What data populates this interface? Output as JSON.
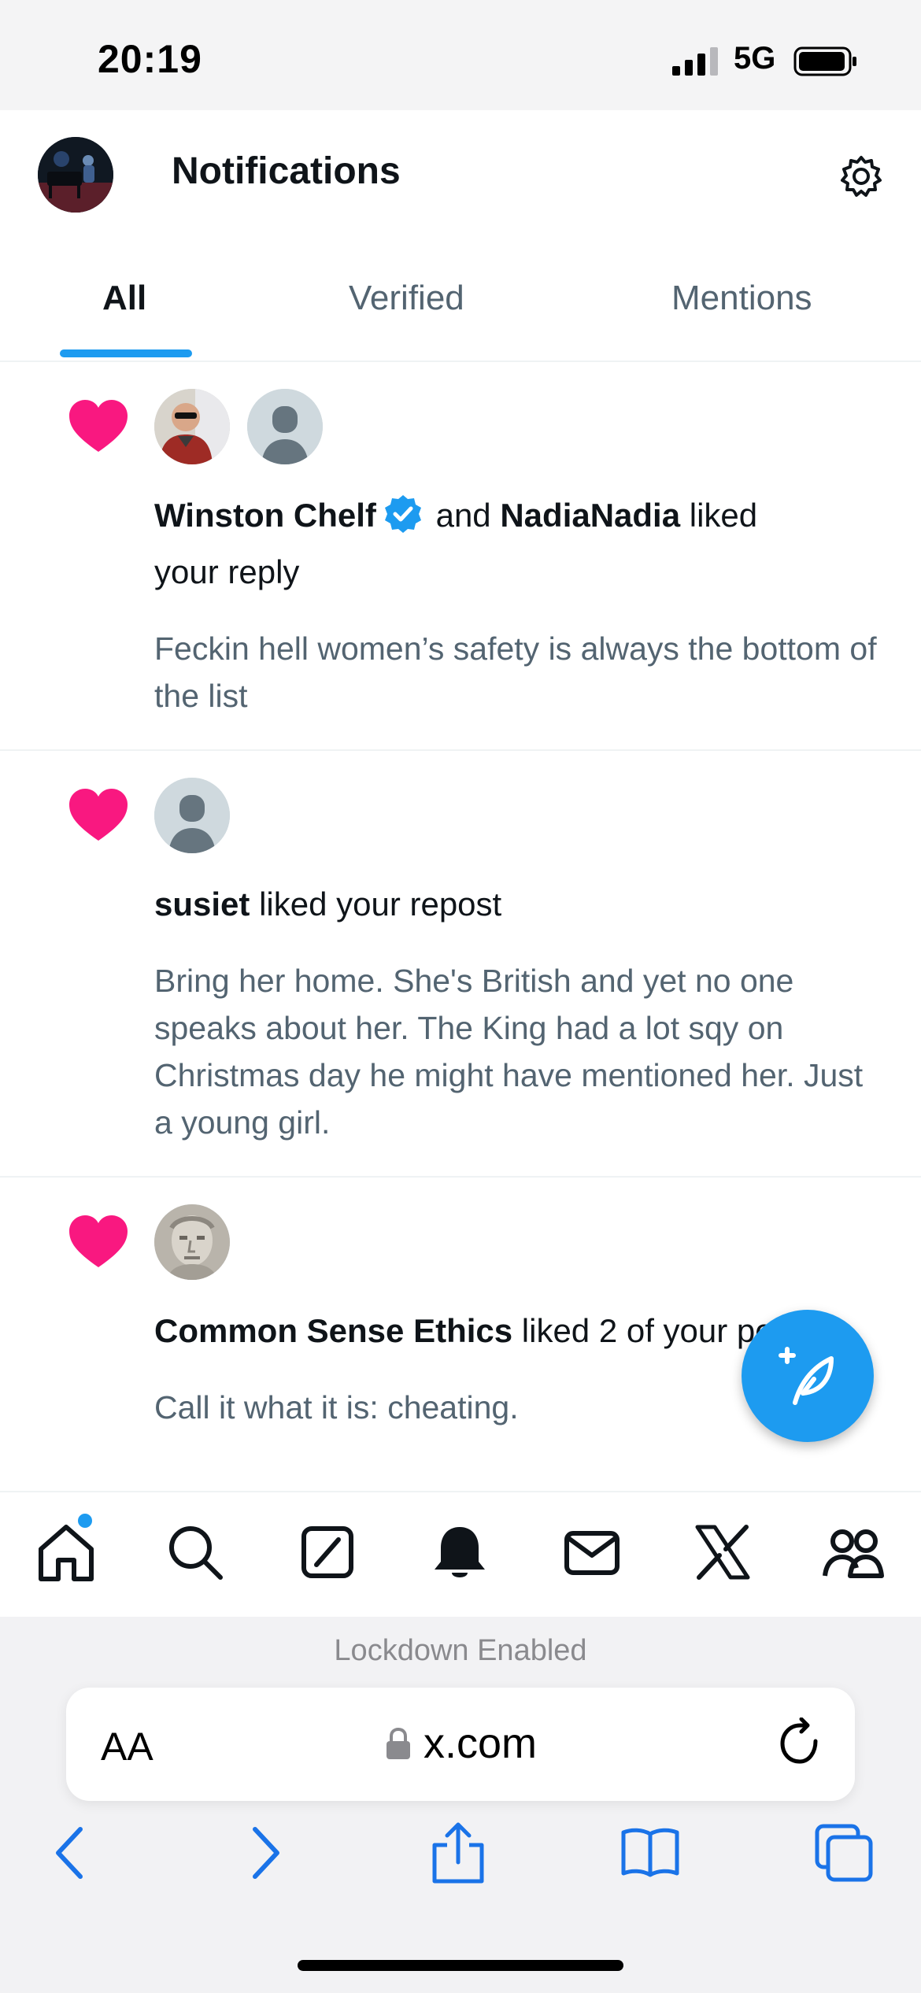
{
  "status_bar": {
    "time": "20:19",
    "network": "5G"
  },
  "header": {
    "title": "Notifications",
    "settings_icon": "gear-icon"
  },
  "tabs": [
    {
      "label": "All",
      "active": true
    },
    {
      "label": "Verified",
      "active": false
    },
    {
      "label": "Mentions",
      "active": false
    }
  ],
  "notifications": [
    {
      "type": "like",
      "user1": "Winston Chelf",
      "conj": "and",
      "user2": "NadiaNadia",
      "action_line1": "liked",
      "action_line2": "your reply",
      "snippet": "Feckin hell women’s safety is always the bottom of the list"
    },
    {
      "type": "like",
      "user": "susiet",
      "action": "liked your repost",
      "snippet": "Bring her home. She's British and yet no one speaks about her. The King had a lot sqy on Christmas day he might have mentioned her. Just a young girl."
    },
    {
      "type": "like",
      "user": "Common Sense Ethics",
      "action": "liked 2 of your posts",
      "snippet": "Call it what it is: cheating."
    }
  ],
  "colors": {
    "accent": "#1d9bf0",
    "heart": "#f91880",
    "secondary_text": "#536471"
  },
  "bottom_nav": [
    "home-icon",
    "search-icon",
    "grok-icon",
    "notifications-icon",
    "messages-icon",
    "x-icon",
    "communities-icon"
  ],
  "safari": {
    "lockdown_label": "Lockdown Enabled",
    "aa_label": "AA",
    "url": "x.com"
  }
}
